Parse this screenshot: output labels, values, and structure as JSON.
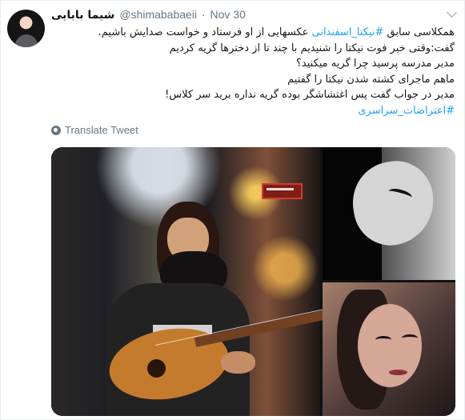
{
  "tweet": {
    "display_name": "شیما بابایی",
    "handle": "@shimababaeii",
    "separator": "·",
    "date": "Nov 30",
    "text_prefix": "همکلاسی سابق ",
    "text_hashtag_1": "#نیکتا_اسفندانی",
    "text_middle": " عکسهایی از او فرستاد و خواست صدایش باشیم.\nگفت:وقتی خبر فوت نیکتا را شنیدیم با چند تا از دخترها گریه کردیم\nمدیر مدرسه پرسید چرا گریه میکنید؟\nماهم ماجرای کشته شدن نیکتا را گفتیم\nمدیر در جواب گفت پس اغتشاشگر بوده گریه نداره برید سر کلاس!\n",
    "text_hashtag_2": "#اعتراضات_سراسری",
    "translate_label": "Translate Tweet"
  },
  "icons": {
    "avatar": "avatar-image",
    "menu": "chevron-down-icon",
    "translate": "globe-icon"
  },
  "media": {
    "main_photo": "girl-playing-guitar-photo",
    "top_right_photo": "black-and-white-portrait-photo",
    "bottom_right_photo": "portrait-photo"
  },
  "colors": {
    "hashtag": "#1da1f2",
    "meta": "#657786",
    "text": "#14171a"
  }
}
